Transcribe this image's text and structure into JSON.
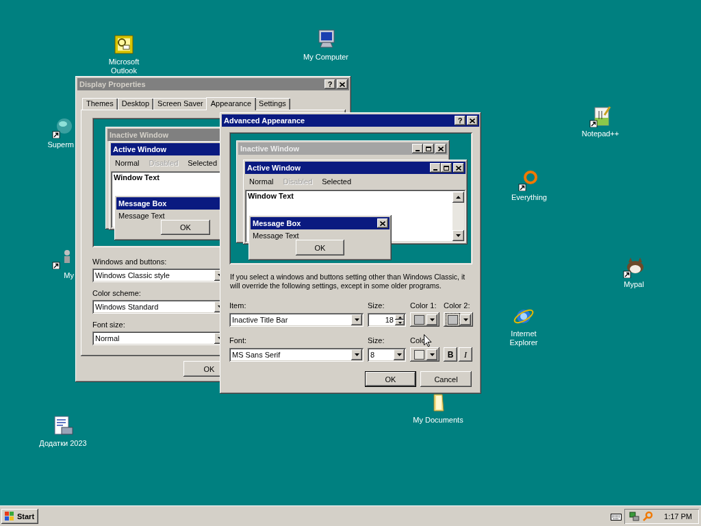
{
  "desktop": {
    "icons": [
      {
        "label": "Microsoft Outlook",
        "kind": "outlook",
        "shortcut": false
      },
      {
        "label": "My Computer",
        "kind": "computer",
        "shortcut": false
      },
      {
        "label": "Superm",
        "kind": "globe",
        "shortcut": true
      },
      {
        "label": "My",
        "kind": "generic",
        "shortcut": true
      },
      {
        "label": "Notepad++",
        "kind": "notepad",
        "shortcut": true
      },
      {
        "label": "Everything",
        "kind": "ring",
        "shortcut": true
      },
      {
        "label": "Mypal",
        "kind": "animal",
        "shortcut": true
      },
      {
        "label": "Internet Explorer",
        "kind": "ie",
        "shortcut": false
      },
      {
        "label": "My Documents",
        "kind": "folder",
        "shortcut": false
      },
      {
        "label": "Додатки 2023",
        "kind": "document",
        "shortcut": false
      }
    ]
  },
  "display_properties": {
    "title": "Display Properties",
    "active": false,
    "help_button": "?",
    "tabs": [
      {
        "label": "Themes",
        "selected": false
      },
      {
        "label": "Desktop",
        "selected": false
      },
      {
        "label": "Screen Saver",
        "selected": false
      },
      {
        "label": "Appearance",
        "selected": true
      },
      {
        "label": "Settings",
        "selected": false
      }
    ],
    "preview": {
      "inactive_title": "Inactive Window",
      "active_title": "Active Window",
      "menu": [
        {
          "label": "Normal",
          "disabled": false
        },
        {
          "label": "Disabled",
          "disabled": true
        },
        {
          "label": "Selected",
          "disabled": false
        }
      ],
      "window_text": "Window Text",
      "message_box_title": "Message Box",
      "message_text": "Message Text",
      "ok": "OK"
    },
    "fields": [
      {
        "label": "Windows and buttons:",
        "value": "Windows Classic style"
      },
      {
        "label": "Color scheme:",
        "value": "Windows Standard"
      },
      {
        "label": "Font size:",
        "value": "Normal"
      }
    ],
    "buttons": [
      "OK"
    ]
  },
  "advanced_appearance": {
    "title": "Advanced Appearance",
    "active": true,
    "help_button": "?",
    "preview": {
      "inactive_title": "Inactive Window",
      "active_title": "Active Window",
      "menu": [
        {
          "label": "Normal",
          "disabled": false
        },
        {
          "label": "Disabled",
          "disabled": true
        },
        {
          "label": "Selected",
          "disabled": false
        }
      ],
      "window_text": "Window Text",
      "message_box_title": "Message Box",
      "message_text": "Message Text",
      "ok": "OK"
    },
    "note": "If you select a windows and buttons setting other than Windows Classic, it will override the following settings, except in some older programs.",
    "item": {
      "label": "Item:",
      "value": "Inactive Title Bar"
    },
    "item_size": {
      "label": "Size:",
      "value": "18"
    },
    "item_colors": [
      {
        "label": "Color 1:",
        "color": "#c0c0c0"
      },
      {
        "label": "Color 2:",
        "color": "#c0c0c0"
      }
    ],
    "font": {
      "label": "Font:",
      "value": "MS Sans Serif"
    },
    "font_size": {
      "label": "Size:",
      "value": "8"
    },
    "font_color": {
      "label": "Colo",
      "color": "#e4e2dc"
    },
    "bold_button": "B",
    "italic_button": "I",
    "buttons": [
      {
        "label": "OK",
        "default": true
      },
      {
        "label": "Cancel",
        "default": false
      }
    ]
  },
  "taskbar": {
    "start": "Start",
    "clock": "1:17 PM"
  }
}
